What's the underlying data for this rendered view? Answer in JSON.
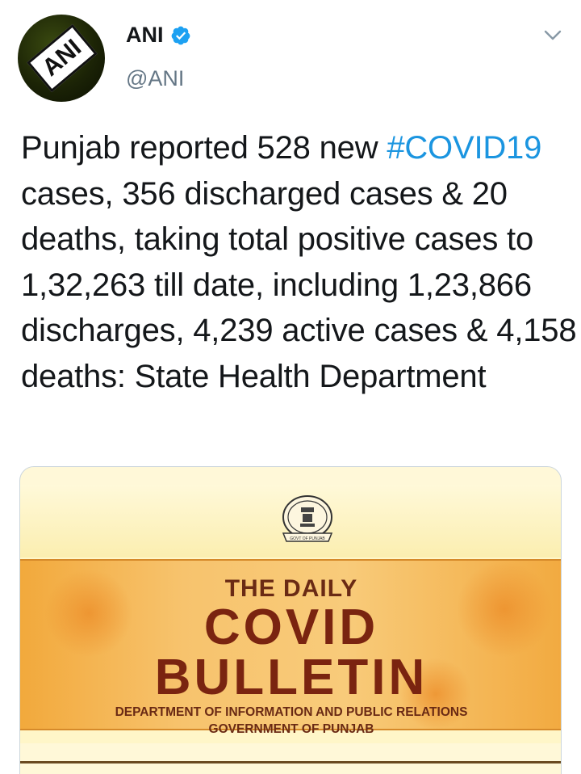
{
  "author": {
    "name": "ANI",
    "handle": "@ANI",
    "avatar_text": "ANI",
    "verified": true
  },
  "tweet": {
    "text_before": "Punjab reported 528 new ",
    "hashtag": "#COVID19",
    "text_after": " cases, 356 discharged cases & 20 deaths, taking total positive cases to 1,32,263 till date, including 1,23,866 discharges, 4,239 active cases & 4,158 deaths: State Health Department"
  },
  "media": {
    "line1": "THE DAILY",
    "line2": "COVID",
    "line3": "BULLETIN",
    "line4": "DEPARTMENT OF INFORMATION AND PUBLIC RELATIONS",
    "line5": "GOVERNMENT OF PUNJAB",
    "seal_text": "GOVT OF PUNJAB"
  },
  "icons": {
    "verified": "verified-badge-icon",
    "menu": "chevron-down-icon"
  },
  "colors": {
    "link": "#1b95e0",
    "text": "#14171a",
    "secondary": "#657786",
    "verified": "#1da1f2"
  }
}
